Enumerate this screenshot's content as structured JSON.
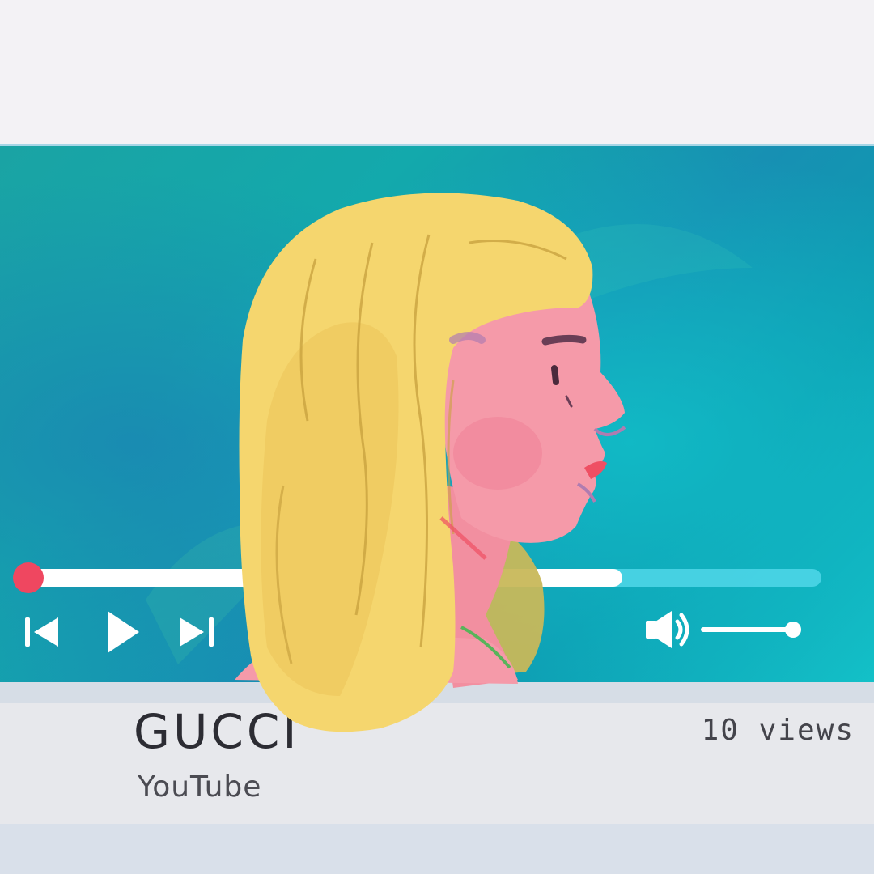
{
  "video": {
    "title": "GUCCI",
    "channel": "YouTube",
    "views": "10 views",
    "progress_fraction": 0.75,
    "volume_fraction": 1.0
  },
  "controls": {
    "icons": [
      "skip-back-icon",
      "play-icon",
      "skip-forward-icon",
      "volume-icon"
    ]
  },
  "colors": {
    "video_bg_a": "#1aa3a4",
    "video_bg_b": "#1790b3",
    "hair": "#f5d66e",
    "skin": "#f59aa9",
    "progress_knob": "#ef4760",
    "progress_remaining": "#50d7e9"
  }
}
